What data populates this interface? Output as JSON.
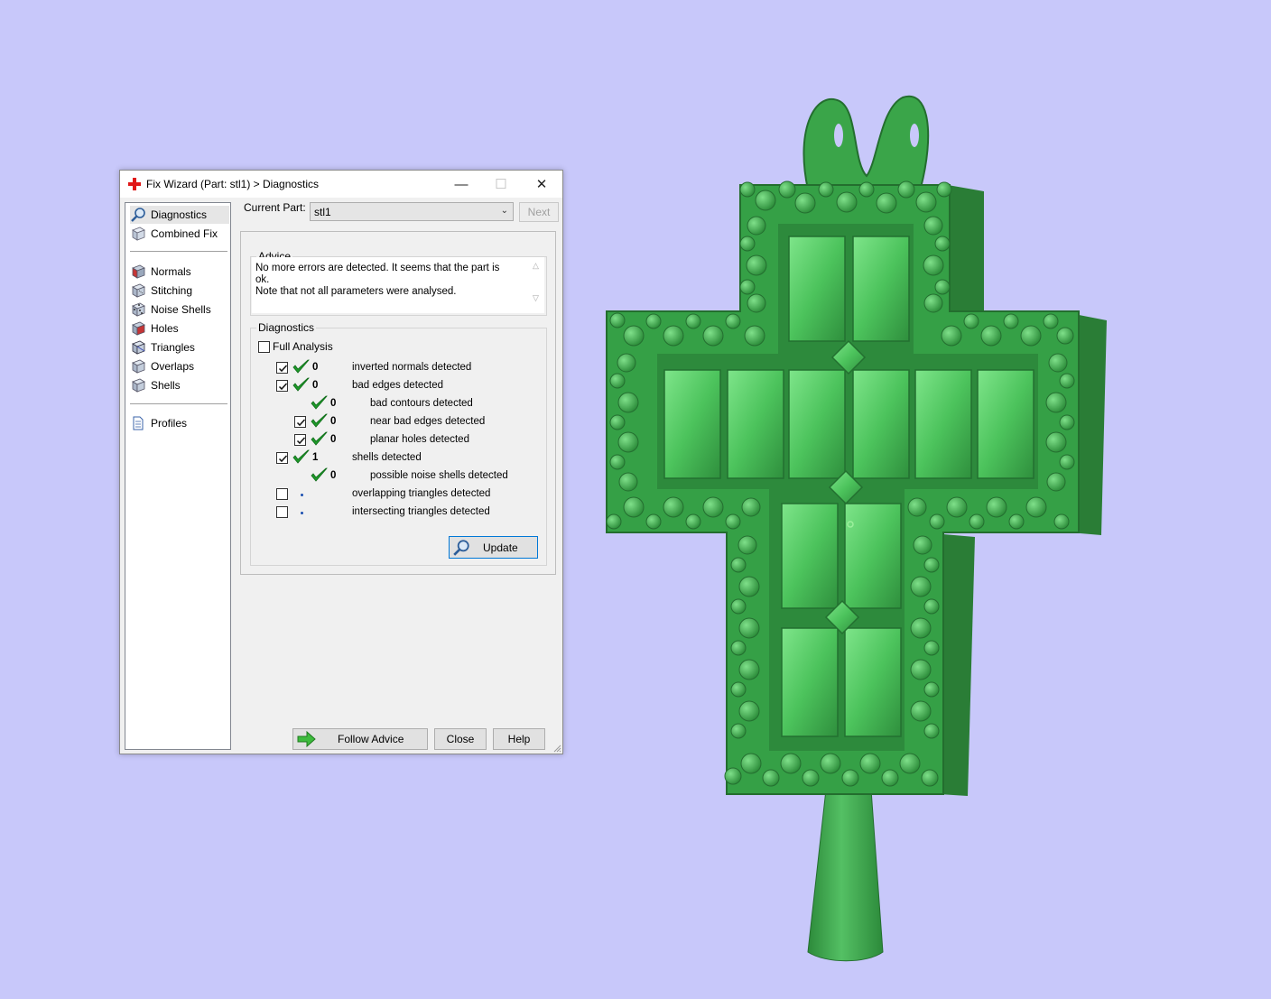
{
  "window": {
    "title": "Fix Wizard (Part: stl1) > Diagnostics",
    "controls": {
      "minimize": "—",
      "maximize": "☐",
      "close": "✕"
    }
  },
  "sidebar": {
    "top_items": [
      {
        "label": "Diagnostics",
        "icon": "magnifier-icon",
        "active": true
      },
      {
        "label": "Combined Fix",
        "icon": "combined-fix-cube-icon"
      }
    ],
    "fix_items": [
      {
        "label": "Normals",
        "icon": "normals-cube-icon"
      },
      {
        "label": "Stitching",
        "icon": "stitching-cube-icon"
      },
      {
        "label": "Noise Shells",
        "icon": "noise-shells-cube-icon"
      },
      {
        "label": "Holes",
        "icon": "holes-cube-icon"
      },
      {
        "label": "Triangles",
        "icon": "triangles-cube-icon"
      },
      {
        "label": "Overlaps",
        "icon": "overlaps-cube-icon"
      },
      {
        "label": "Shells",
        "icon": "shells-cube-icon"
      }
    ],
    "bottom_items": [
      {
        "label": "Profiles",
        "icon": "profiles-document-icon"
      }
    ]
  },
  "current_part": {
    "label": "Current Part:",
    "value": "stl1",
    "next_label": "Next"
  },
  "advice": {
    "title": "Advice",
    "line1": "No more errors are detected. It seems that the part is ok.",
    "line2": "Note that not all parameters were analysed."
  },
  "diagnostics": {
    "title": "Diagnostics",
    "full_analysis_label": "Full Analysis",
    "full_analysis_checked": false,
    "rows": [
      {
        "level": 0,
        "has_checkbox": true,
        "checked": true,
        "status": "ok",
        "count": "0",
        "label": "inverted normals detected"
      },
      {
        "level": 0,
        "has_checkbox": true,
        "checked": true,
        "status": "ok",
        "count": "0",
        "label": "bad edges detected"
      },
      {
        "level": 1,
        "has_checkbox": false,
        "checked": false,
        "status": "ok",
        "count": "0",
        "label": "bad contours detected"
      },
      {
        "level": 1,
        "has_checkbox": true,
        "checked": true,
        "status": "ok",
        "count": "0",
        "label": "near bad edges detected"
      },
      {
        "level": 1,
        "has_checkbox": true,
        "checked": true,
        "status": "ok",
        "count": "0",
        "label": "planar holes detected"
      },
      {
        "level": 0,
        "has_checkbox": true,
        "checked": true,
        "status": "ok",
        "count": "1",
        "label": "shells detected"
      },
      {
        "level": 1,
        "has_checkbox": false,
        "checked": false,
        "status": "ok",
        "count": "0",
        "label": "possible noise shells detected"
      },
      {
        "level": 0,
        "has_checkbox": true,
        "checked": false,
        "status": "not-analysed",
        "count": "",
        "label": "overlapping triangles detected"
      },
      {
        "level": 0,
        "has_checkbox": true,
        "checked": false,
        "status": "not-analysed",
        "count": "",
        "label": "intersecting triangles detected"
      }
    ],
    "update_label": "Update"
  },
  "footer": {
    "follow_advice": "Follow Advice",
    "close": "Close",
    "help": "Help"
  },
  "colors": {
    "viewport_bg": "#c8c8fa",
    "model_green": "#3fae4f",
    "check_green": "#1e9a2a",
    "accent_red": "#e81123"
  },
  "scene": {
    "object": "green-cross-pendant-3d-model"
  }
}
